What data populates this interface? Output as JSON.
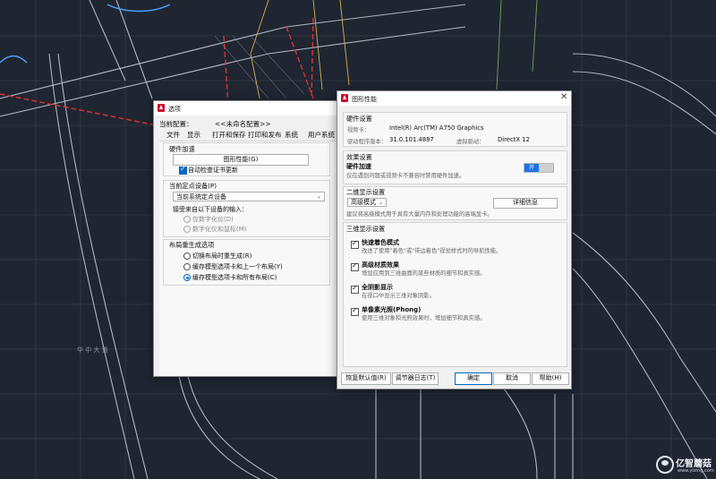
{
  "background": {
    "road_label": "华 中 大 道"
  },
  "watermark": {
    "brand": "亿智蘑菇",
    "url": "www.yizmg.com"
  },
  "options_dialog": {
    "title": "选项",
    "current_profile_label": "当前配置：",
    "current_profile_value": "<<未命名配置>>",
    "tabs": [
      "文件",
      "显示",
      "打开和保存",
      "打印和发布",
      "系统",
      "用户系统"
    ],
    "hardware_accel": {
      "title": "硬件加速",
      "button": "图形性能(G)",
      "check_label": "自动检查证书更新"
    },
    "pointing_device": {
      "title": "当前定点设备(P)",
      "selected": "当前系统定点设备",
      "accept_label": "接受来自以下设备的输入：",
      "options": [
        "仅数字化仪(D)",
        "数字化仪和鼠标(M)"
      ]
    },
    "layout_regen": {
      "title": "布局重生成选项",
      "options": [
        "切换布局时重生成(R)",
        "缓存模型选项卡和上一个布局(Y)",
        "缓存模型选项卡和所有布局(C)"
      ]
    }
  },
  "graphics_dialog": {
    "title": "图形性能",
    "hardware": {
      "title": "硬件设置",
      "card_label": "视频卡：",
      "card_value": "Intel(R) Arc(TM) A750 Graphics",
      "driver_label": "驱动程序版本：",
      "driver_value": "31.0.101.4887",
      "vdriver_label": "虚拟驱动：",
      "vdriver_value": "DirectX 12"
    },
    "effects": {
      "title": "效果设置",
      "accel_label": "硬件加速",
      "accel_desc": "仅在遇到问题或视频卡不兼容时禁用硬件加速。",
      "toggle": "开"
    },
    "display2d": {
      "title": "二维显示设置",
      "mode": "高级模式",
      "details_button": "详细信息",
      "desc": "建议将高级模式用于具有大量内存和处理功能的高端显卡。"
    },
    "display3d": {
      "title": "三维显示设置",
      "items": [
        {
          "label": "快速着色模式",
          "desc": "改进了使用\"着色\"或\"带边着色\"视觉样式时的导航性能。"
        },
        {
          "label": "高级材质效果",
          "desc": "增加应用到三维曲面的某些材质的细节和真实感。"
        },
        {
          "label": "全阴影显示",
          "desc": "在视口中显示三维对象阴影。"
        },
        {
          "label": "单像素光照(Phong)",
          "desc": "使用三维对象和光照效果时，增加细节和真实感。"
        }
      ]
    },
    "buttons": {
      "reset": "恢复默认值(R)",
      "log": "调节器日志(T)",
      "ok": "确定",
      "cancel": "取消",
      "help": "帮助(H)"
    }
  }
}
